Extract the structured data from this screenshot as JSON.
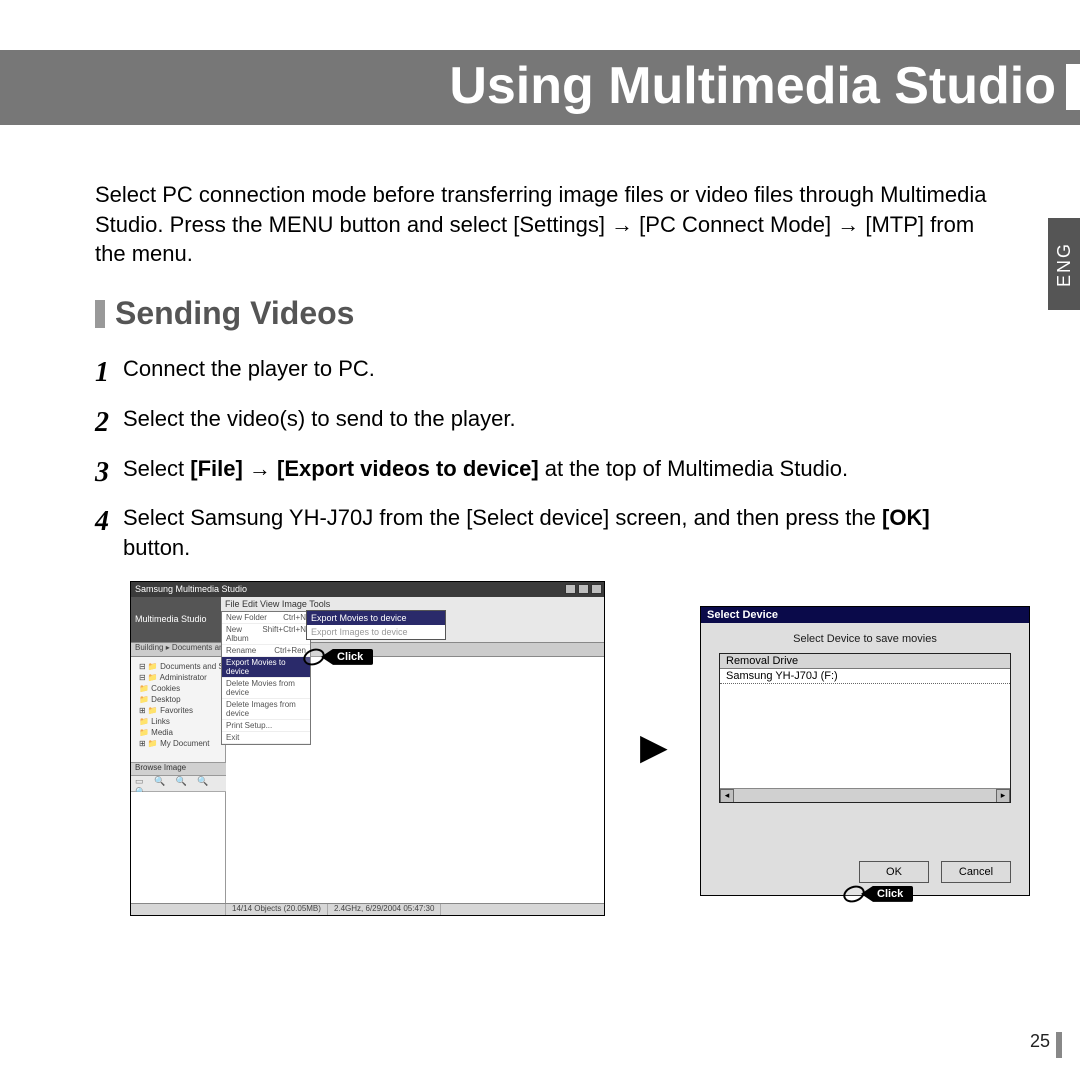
{
  "header": {
    "title": "Using Multimedia Studio"
  },
  "lang_tab": "ENG",
  "intro": "Select PC connection mode before transferring image files or video files through Multimedia Studio. Press the MENU button and select [Settings] → [PC Connect Mode] → [MTP] from the menu.",
  "section": {
    "title": "Sending Videos"
  },
  "steps": {
    "s1n": "1",
    "s1": "Connect the player to PC.",
    "s2n": "2",
    "s2": "Select the video(s) to send to the player.",
    "s3n": "3",
    "s3_pre": "Select ",
    "s3_bold": "[File] → [Export videos to device]",
    "s3_post": " at the top of Multimedia Studio.",
    "s4n": "4",
    "s4_pre": "Select Samsung YH-J70J from the [Select device] screen, and then press the ",
    "s4_bold": "[OK]",
    "s4_post": " button."
  },
  "appwin": {
    "titlebar": "Samsung Multimedia Studio",
    "brand": "Multimedia Studio",
    "menubar": "File  Edit  View  Image  Tools",
    "filemenu": {
      "i1l": "New Folder",
      "i1r": "Ctrl+N",
      "i2l": "New Album",
      "i2r": "Shift+Ctrl+N",
      "i3l": "Rename",
      "i3r": "Ctrl+Ren",
      "hl": "Export Movies to device",
      "i5l": "Delete Movies from device",
      "i6l": "Delete Images from device",
      "i8l": "Print Setup...",
      "i9l": "Exit"
    },
    "submenu": {
      "a": "Export Movies to device",
      "b": "Export Images to device"
    },
    "tabs": "Building   ▸ Documents and Sett",
    "tree": {
      "t1": "⊟ 📁 Documents and Sett",
      "t2": "  ⊟ 📁 Administrator",
      "t3": "    📁 Cookies",
      "t4": "    📁 Desktop",
      "t5": "  ⊞ 📁 Favorites",
      "t6": "    📁 Links",
      "t7": "    📁 Media",
      "t8": "  ⊞ 📁 My Document"
    },
    "browse": "Browse Image",
    "status_left": "14/14 Objects (20.05MB)",
    "status_right": "2.4GHz, 6/29/2004 05:47:30"
  },
  "dialog": {
    "title": "Select Device",
    "prompt": "Select Device to save movies",
    "group": "Removal Drive",
    "item": "Samsung YH-J70J (F:)",
    "ok": "OK",
    "cancel": "Cancel"
  },
  "callouts": {
    "click": "Click"
  },
  "arrow": "▶",
  "page": "25"
}
